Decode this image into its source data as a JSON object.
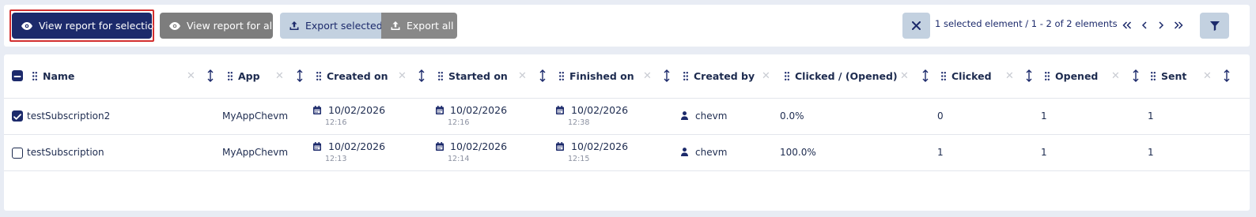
{
  "toolbar": {
    "view_selection_label": "View report for selection",
    "view_all_label": "View report for all",
    "export_selected_label": "Export selected",
    "export_all_label": "Export all",
    "selection_status": "1 selected element / 1 - 2 of 2 elements"
  },
  "table": {
    "columns": [
      {
        "label": "Name"
      },
      {
        "label": "App"
      },
      {
        "label": "Created on"
      },
      {
        "label": "Started on"
      },
      {
        "label": "Finished on"
      },
      {
        "label": "Created by"
      },
      {
        "label": "Clicked / (Opened)"
      },
      {
        "label": "Clicked"
      },
      {
        "label": "Opened"
      },
      {
        "label": "Sent"
      }
    ],
    "rows": [
      {
        "checked": true,
        "name": "testSubscription2",
        "app": "MyAppChevm",
        "created_date": "10/02/2026",
        "created_time": "12:16",
        "started_date": "10/02/2026",
        "started_time": "12:16",
        "finished_date": "10/02/2026",
        "finished_time": "12:38",
        "created_by": "chevm",
        "ratio": "0.0%",
        "clicked": "0",
        "opened": "1",
        "sent": "1"
      },
      {
        "checked": false,
        "name": "testSubscription",
        "app": "MyAppChevm",
        "created_date": "10/02/2026",
        "created_time": "12:13",
        "started_date": "10/02/2026",
        "started_time": "12:14",
        "finished_date": "10/02/2026",
        "finished_time": "12:15",
        "created_by": "chevm",
        "ratio": "100.0%",
        "clicked": "1",
        "opened": "1",
        "sent": "1"
      }
    ]
  },
  "icons": {
    "eye": "eye-icon",
    "upload": "upload-icon",
    "close": "close-icon",
    "first": "double-chevron-left-icon",
    "prev": "chevron-left-icon",
    "next": "chevron-right-icon",
    "last": "double-chevron-right-icon",
    "filter": "filter-icon",
    "drag": "drag-handle-icon",
    "clear": "clear-filter-icon",
    "sort": "sort-icon",
    "calendar": "calendar-icon",
    "user": "user-icon"
  },
  "colors": {
    "primary": "#1c2a6b",
    "highlight_border": "#d32f2f",
    "secondary_button": "#c3d1e0",
    "gray_button": "#7d7d7d",
    "background": "#e8ecf4"
  }
}
